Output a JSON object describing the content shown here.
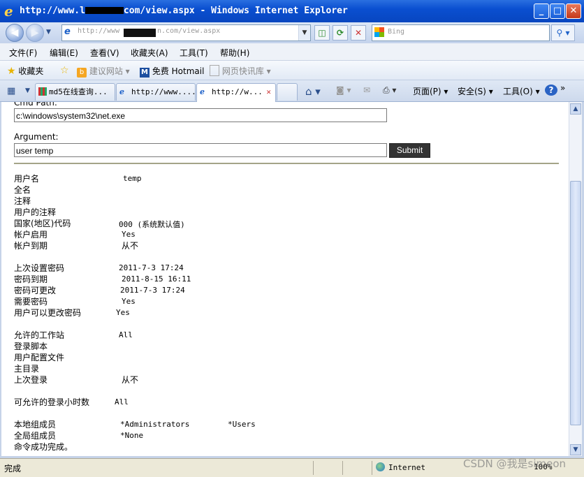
{
  "window": {
    "title_prefix": "http://www.l",
    "title_suffix": "com/view.aspx - Windows Internet Explorer",
    "minimize": "_",
    "maximize": "□",
    "close": "✕"
  },
  "nav": {
    "back": "◀",
    "forward": "▶",
    "address_prefix": "http://www",
    "address_suffix": "n.com/view.aspx",
    "search_placeholder": "Bing"
  },
  "menu": [
    "文件(F)",
    "编辑(E)",
    "查看(V)",
    "收藏夹(A)",
    "工具(T)",
    "帮助(H)"
  ],
  "favorites": {
    "label": "收藏夹",
    "suggested": "建议网站 ▾",
    "hotmail": "免费 Hotmail",
    "webslice": "网页快讯库 ▾"
  },
  "tabs": [
    {
      "label": "md5在线查询..."
    },
    {
      "label": "http://www...."
    },
    {
      "label": "http://w..."
    }
  ],
  "commands": {
    "page": "页面(P) ▾",
    "safety": "安全(S) ▾",
    "tools": "工具(O) ▾",
    "help": "?"
  },
  "form": {
    "cmd_label": "Cmd Path:",
    "cmd_value": "c:\\windows\\system32\\net.exe",
    "arg_label": "Argument:",
    "arg_value": "user temp",
    "submit": "Submit"
  },
  "output": [
    {
      "k": "用户名",
      "v": "temp"
    },
    {
      "k": "全名",
      "v": ""
    },
    {
      "k": "注释",
      "v": ""
    },
    {
      "k": "用户的注释",
      "v": ""
    },
    {
      "k": "国家(地区)代码",
      "v": "000 (系统默认值)"
    },
    {
      "k": "帐户启用",
      "v": "Yes"
    },
    {
      "k": "帐户到期",
      "v": "从不"
    },
    {
      "k": "上次设置密码",
      "v": "2011-7-3 17:24"
    },
    {
      "k": "密码到期",
      "v": "2011-8-15 16:11"
    },
    {
      "k": "密码可更改",
      "v": "2011-7-3 17:24"
    },
    {
      "k": "需要密码",
      "v": "Yes"
    },
    {
      "k": "用户可以更改密码",
      "v": "Yes"
    },
    {
      "k": "允许的工作站",
      "v": "All"
    },
    {
      "k": "登录脚本",
      "v": ""
    },
    {
      "k": "用户配置文件",
      "v": ""
    },
    {
      "k": "主目录",
      "v": ""
    },
    {
      "k": "上次登录",
      "v": "从不"
    },
    {
      "k": "可允许的登录小时数",
      "v": "All"
    },
    {
      "k": "本地组成员",
      "v": "*Administrators",
      "v2": "*Users"
    },
    {
      "k": "全局组成员",
      "v": "*None"
    },
    {
      "k": "命令成功完成。",
      "v": ""
    }
  ],
  "status": {
    "text": "完成",
    "zone": "Internet",
    "zoom": "100%"
  },
  "watermark": "CSDN @我是simeon"
}
